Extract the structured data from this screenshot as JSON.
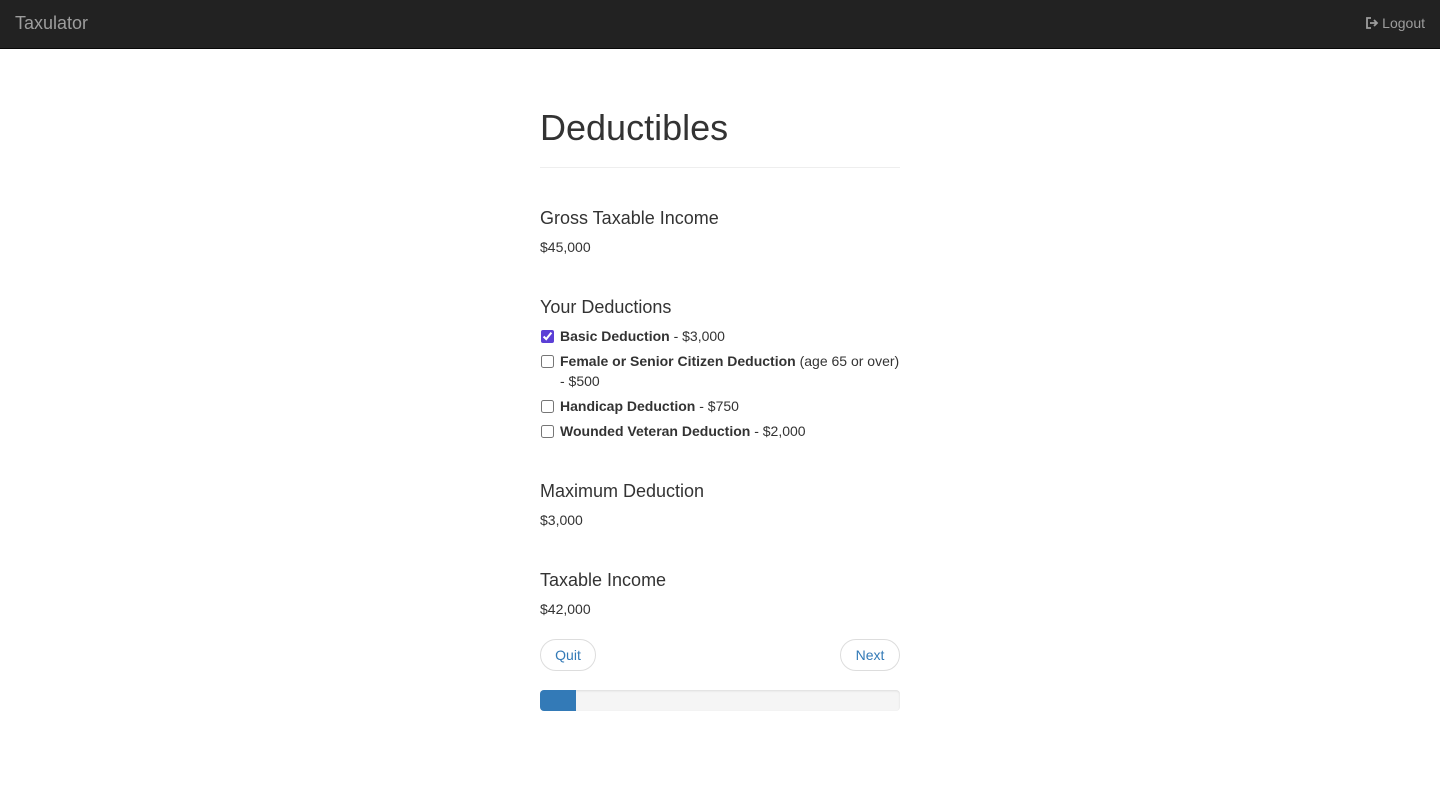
{
  "navbar": {
    "brand": "Taxulator",
    "logout_label": "Logout",
    "logout_icon": "logout-icon"
  },
  "page": {
    "title": "Deductibles"
  },
  "gross": {
    "heading": "Gross Taxable Income",
    "value": "$45,000"
  },
  "deductions": {
    "heading": "Your Deductions",
    "items": [
      {
        "name": "Basic Deduction",
        "detail": "",
        "amount": " - $3,000",
        "checked": true
      },
      {
        "name": "Female or Senior Citizen Deduction",
        "detail": " (age 65 or over)",
        "amount": " - $500",
        "checked": false
      },
      {
        "name": "Handicap Deduction",
        "detail": "",
        "amount": " - $750",
        "checked": false
      },
      {
        "name": "Wounded Veteran Deduction",
        "detail": "",
        "amount": " - $2,000",
        "checked": false
      }
    ]
  },
  "maximum": {
    "heading": "Maximum Deduction",
    "value": "$3,000"
  },
  "taxable": {
    "heading": "Taxable Income",
    "value": "$42,000"
  },
  "buttons": {
    "quit": "Quit",
    "next": "Next"
  },
  "progress": {
    "fraction": 0.1,
    "color": "#337ab7"
  },
  "colors": {
    "navbar_bg": "#222222",
    "link": "#337ab7",
    "checkbox_accent": "#5b3fd6"
  }
}
